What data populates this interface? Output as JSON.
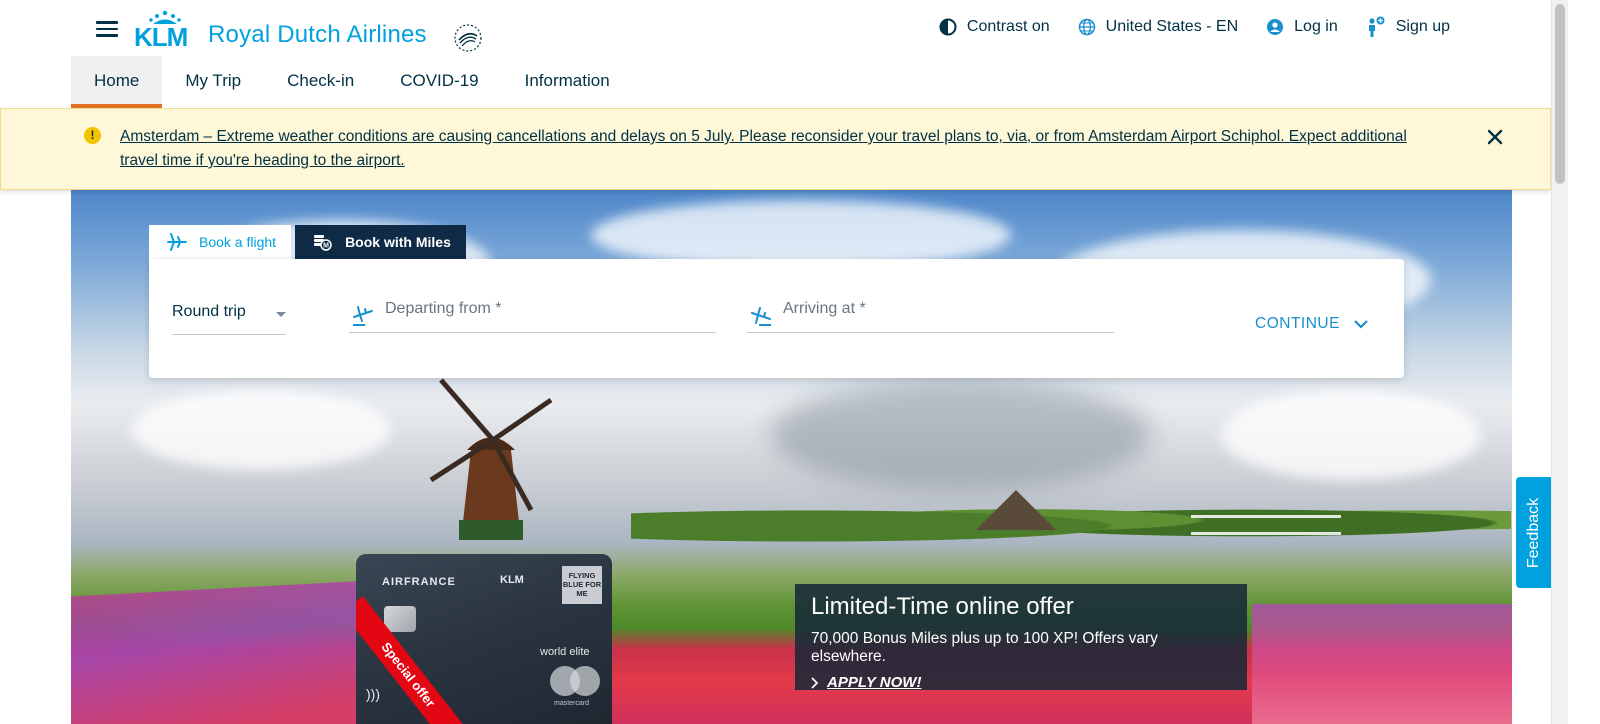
{
  "header": {
    "logo_word": "KLM",
    "logo_text": "Royal Dutch Airlines",
    "skyteam_label": "SKYTEAM",
    "links": {
      "contrast": "Contrast on",
      "region": "United States - EN",
      "login": "Log in",
      "signup": "Sign up"
    },
    "icons": {
      "menu": "hamburger-menu-icon",
      "contrast": "contrast-icon",
      "region": "globe-icon",
      "login": "user-circle-icon",
      "signup": "person-add-icon"
    }
  },
  "nav": {
    "items": [
      {
        "label": "Home",
        "active": true
      },
      {
        "label": "My Trip"
      },
      {
        "label": "Check-in"
      },
      {
        "label": "COVID-19"
      },
      {
        "label": "Information"
      }
    ]
  },
  "alert": {
    "text": "Amsterdam – Extreme weather conditions are causing cancellations and delays on 5 July. Please reconsider your travel plans to, via, or from Amsterdam Airport Schiphol. Expect additional travel time if you're heading to the airport.",
    "icon": "warning-icon",
    "close_icon": "close-icon"
  },
  "booking": {
    "tabs": [
      {
        "label": "Book a flight",
        "icon": "airplane-icon",
        "active": true
      },
      {
        "label": "Book with Miles",
        "icon": "miles-coins-icon"
      }
    ],
    "trip_type": "Round trip",
    "departing_placeholder": "Departing from *",
    "arriving_placeholder": "Arriving at *",
    "continue_label": "CONTINUE"
  },
  "promo": {
    "card": {
      "brand_left": "AIRFRANCE",
      "brand_mid": "KLM",
      "brand_right": "FLYING BLUE FOR ME",
      "tier": "world elite",
      "network": "mastercard",
      "ribbon": "Special offer"
    },
    "offer": {
      "title": "Limited-Time online offer",
      "body": "70,000 Bonus Miles plus up to 100 XP! Offers vary elsewhere.",
      "cta": "APPLY NOW!"
    }
  },
  "feedback_label": "Feedback",
  "colors": {
    "brand_blue": "#00a1de",
    "nav_active_underline": "#e37222",
    "alert_bg": "#fef7d8",
    "miles_tab": "#0e2a44"
  }
}
